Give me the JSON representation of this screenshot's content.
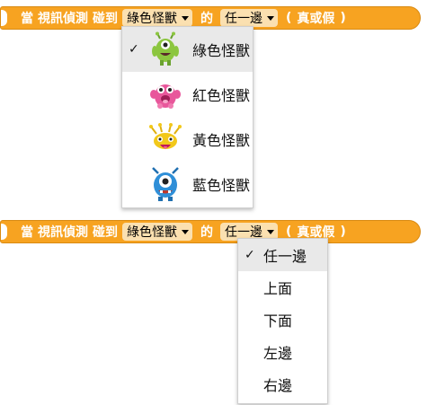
{
  "block1": {
    "when": "當",
    "video_sensing": "視訊偵測",
    "touching": "碰到",
    "sprite_value": "綠色怪獸",
    "of": "的",
    "side_value": "任一邊",
    "paren_open": "(",
    "result_text": "真或假",
    "paren_close": ")"
  },
  "monster_menu": {
    "check_mark": "✓",
    "items": [
      {
        "label": "綠色怪獸",
        "icon": "green-monster-icon",
        "color": "#8cc63f",
        "selected": true
      },
      {
        "label": "紅色怪獸",
        "icon": "pink-monster-icon",
        "color": "#e8579b",
        "selected": false
      },
      {
        "label": "黃色怪獸",
        "icon": "yellow-monster-icon",
        "color": "#f2c81a",
        "selected": false
      },
      {
        "label": "藍色怪獸",
        "icon": "blue-monster-icon",
        "color": "#2f8fd8",
        "selected": false
      }
    ]
  },
  "block2": {
    "when": "當",
    "video_sensing": "視訊偵測",
    "touching": "碰到",
    "sprite_value": "綠色怪獸",
    "of": "的",
    "side_value": "任一邊",
    "paren_open": "(",
    "result_text": "真或假",
    "paren_close": ")"
  },
  "side_menu": {
    "check_mark": "✓",
    "items": [
      {
        "label": "任一邊",
        "selected": true
      },
      {
        "label": "上面",
        "selected": false
      },
      {
        "label": "下面",
        "selected": false
      },
      {
        "label": "左邊",
        "selected": false
      },
      {
        "label": "右邊",
        "selected": false
      }
    ]
  },
  "colors": {
    "block_orange": "#f7a321",
    "dropdown_fill": "#fbe0b0",
    "selected_row": "#e9e9e9"
  }
}
